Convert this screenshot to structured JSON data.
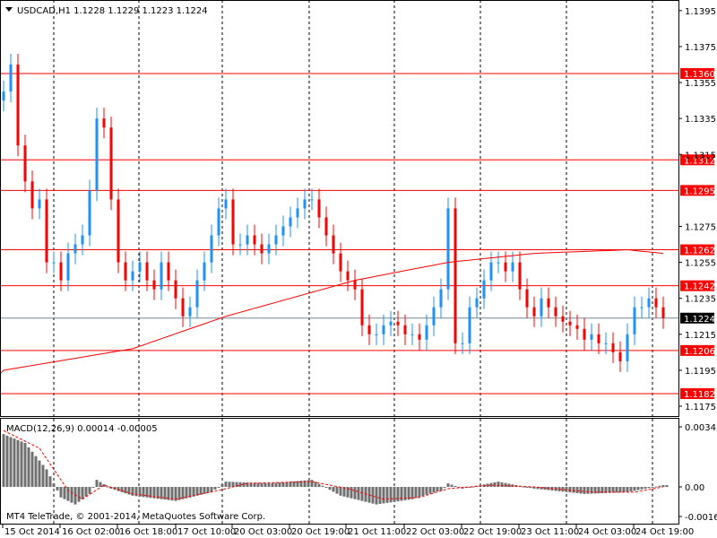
{
  "header": {
    "symbol": "USDCAD,H1",
    "ohlc": "1.1228 1.1229 1.1223 1.1224"
  },
  "macd_label": "MACD(12,26,9) 0.00014 -0.00005",
  "copyright": "MT4 TeleTrade, © 2001-2014, MetaQuotes Software Corp.",
  "colors": {
    "bull": "#1e90ff",
    "bear": "#ff0000",
    "level": "#ff0000",
    "ma": "#ff0000",
    "hist": "#707070",
    "signal": "#ff0000"
  },
  "chart_data": {
    "type": "candlestick",
    "price_ticks": [
      "1.1395",
      "1.1375",
      "1.1355",
      "1.1335",
      "1.1315",
      "1.1275",
      "1.1255",
      "1.1235",
      "1.1215",
      "1.1195",
      "1.1175"
    ],
    "price_range": [
      1.117,
      1.1405
    ],
    "levels": [
      "1.1360",
      "1.1312",
      "1.1295",
      "1.1262",
      "1.1242",
      "1.1206",
      "1.1182"
    ],
    "current_price": "1.1224",
    "time_labels": [
      "15 Oct 2014",
      "16 Oct 02:00",
      "16 Oct 18:00",
      "17 Oct 10:00",
      "20 Oct 03:00",
      "20 Oct 19:00",
      "21 Oct 11:00",
      "22 Oct 03:00",
      "22 Oct 19:00",
      "23 Oct 11:00",
      "24 Oct 03:00",
      "24 Oct 19:00"
    ],
    "closes": [
      1.135,
      1.1365,
      1.132,
      1.13,
      1.1285,
      1.129,
      1.1255,
      1.1255,
      1.1245,
      1.126,
      1.1265,
      1.127,
      1.1295,
      1.1335,
      1.133,
      1.129,
      1.1255,
      1.1245,
      1.125,
      1.1255,
      1.1245,
      1.124,
      1.1255,
      1.1245,
      1.1235,
      1.1225,
      1.123,
      1.1245,
      1.1255,
      1.127,
      1.1285,
      1.129,
      1.1265,
      1.1265,
      1.127,
      1.1265,
      1.126,
      1.1265,
      1.127,
      1.1275,
      1.128,
      1.1285,
      1.129,
      1.129,
      1.128,
      1.127,
      1.126,
      1.125,
      1.1245,
      1.124,
      1.122,
      1.1215,
      1.1215,
      1.122,
      1.1222,
      1.122,
      1.1215,
      1.1215,
      1.1212,
      1.122,
      1.123,
      1.124,
      1.1285,
      1.121,
      1.121,
      1.123,
      1.1235,
      1.1245,
      1.1255,
      1.1255,
      1.125,
      1.1255,
      1.124,
      1.123,
      1.1225,
      1.1235,
      1.123,
      1.1225,
      1.1222,
      1.122,
      1.1218,
      1.1212,
      1.1215,
      1.121,
      1.121,
      1.1205,
      1.12,
      1.1215,
      1.123,
      1.123,
      1.1235,
      1.123,
      1.1224
    ],
    "ma_points": [
      [
        0,
        1.1195
      ],
      [
        18,
        1.1207
      ],
      [
        31,
        1.1225
      ],
      [
        49,
        1.1245
      ],
      [
        62,
        1.1255
      ],
      [
        74,
        1.126
      ],
      [
        87,
        1.1262
      ],
      [
        92,
        1.126
      ]
    ],
    "macd_range": [
      -0.00167,
      0.00342
    ],
    "macd_ticks": [
      "0.00342",
      "0.00",
      "-0.00167"
    ],
    "macd_hist_points": [
      [
        0,
        0.003
      ],
      [
        3,
        0.0025
      ],
      [
        6,
        0.001
      ],
      [
        8,
        -0.0006
      ],
      [
        10,
        -0.001
      ],
      [
        12,
        -0.0004
      ],
      [
        13,
        0.0004
      ],
      [
        15,
        -0.0001
      ],
      [
        18,
        -0.0005
      ],
      [
        24,
        -0.0008
      ],
      [
        29,
        -0.0003
      ],
      [
        31,
        0.0003
      ],
      [
        37,
        0.0002
      ],
      [
        43,
        0.0004
      ],
      [
        47,
        -0.0005
      ],
      [
        52,
        -0.001
      ],
      [
        57,
        -0.0007
      ],
      [
        61,
        -0.0002
      ],
      [
        62,
        0.0002
      ],
      [
        64,
        -0.0001
      ],
      [
        69,
        0.0003
      ],
      [
        74,
        -0.0001
      ],
      [
        81,
        -0.0004
      ],
      [
        87,
        -0.0003
      ],
      [
        92,
        0.0001
      ]
    ],
    "macd_signal_points": [
      [
        0,
        0.0032
      ],
      [
        5,
        0.0022
      ],
      [
        9,
        -0.0002
      ],
      [
        11,
        -0.0007
      ],
      [
        14,
        0.0001
      ],
      [
        18,
        -0.0004
      ],
      [
        24,
        -0.0007
      ],
      [
        30,
        -0.0002
      ],
      [
        34,
        0.0002
      ],
      [
        43,
        0.0003
      ],
      [
        48,
        -0.0001
      ],
      [
        53,
        -0.0007
      ],
      [
        58,
        -0.0006
      ],
      [
        62,
        -0.0001
      ],
      [
        68,
        0.0001
      ],
      [
        74,
        0.0
      ],
      [
        82,
        -0.0003
      ],
      [
        88,
        -0.0003
      ],
      [
        92,
        0.0
      ]
    ]
  }
}
